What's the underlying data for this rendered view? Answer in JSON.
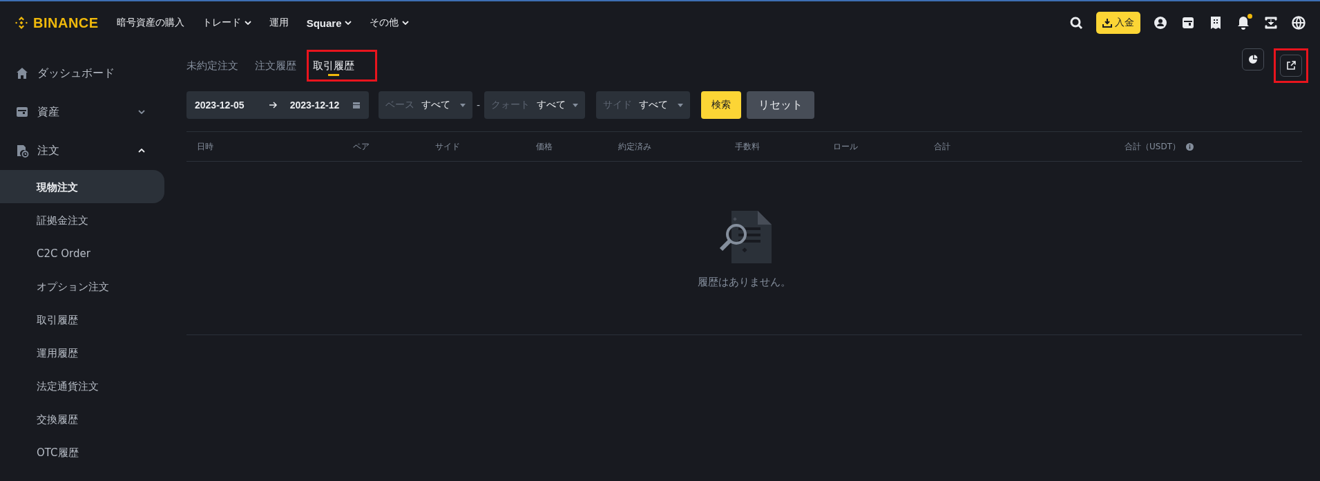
{
  "header": {
    "logo": "BINANCE",
    "nav": [
      {
        "label": "暗号資産の購入",
        "dropdown": false,
        "bold": false
      },
      {
        "label": "トレード",
        "dropdown": true,
        "bold": false
      },
      {
        "label": "運用",
        "dropdown": false,
        "bold": false
      },
      {
        "label": "Square",
        "dropdown": true,
        "bold": true
      },
      {
        "label": "その他",
        "dropdown": true,
        "bold": false
      }
    ],
    "deposit_button": "入金",
    "notification_badge": true
  },
  "sidebar": {
    "items": [
      {
        "label": "ダッシュボード",
        "kind": "link"
      },
      {
        "label": "資産",
        "kind": "group",
        "expanded": false
      },
      {
        "label": "注文",
        "kind": "group",
        "expanded": true,
        "children": [
          {
            "label": "現物注文",
            "selected": true
          },
          {
            "label": "証拠金注文",
            "selected": false
          },
          {
            "label": "C2C Order",
            "selected": false
          },
          {
            "label": "オプション注文",
            "selected": false
          },
          {
            "label": "取引履歴",
            "selected": false
          },
          {
            "label": "運用履歴",
            "selected": false
          },
          {
            "label": "法定通貨注文",
            "selected": false
          },
          {
            "label": "交換履歴",
            "selected": false
          },
          {
            "label": "OTC履歴",
            "selected": false
          }
        ]
      }
    ]
  },
  "tabs": [
    {
      "label": "未約定注文",
      "selected": false,
      "highlighted": false
    },
    {
      "label": "注文履歴",
      "selected": false,
      "highlighted": false
    },
    {
      "label": "取引履歴",
      "selected": true,
      "highlighted": true
    }
  ],
  "toolbar_buttons": [
    {
      "kind": "chart",
      "highlighted": false
    },
    {
      "kind": "export",
      "highlighted": true
    }
  ],
  "filters": {
    "date_start": "2023-12-05",
    "date_end": "2023-12-12",
    "selects": [
      {
        "label": "ベース",
        "value": "すべて"
      },
      {
        "label": "クォート",
        "value": "すべて"
      },
      {
        "label": "サイド",
        "value": "すべて"
      }
    ],
    "pair_separator": "-",
    "search_button": "検索",
    "reset_button": "リセット"
  },
  "table": {
    "columns": [
      {
        "label": "日時",
        "info": false
      },
      {
        "label": "ペア",
        "info": false
      },
      {
        "label": "サイド",
        "info": false
      },
      {
        "label": "価格",
        "info": false
      },
      {
        "label": "約定済み",
        "info": false
      },
      {
        "label": "手数料",
        "info": false
      },
      {
        "label": "ロール",
        "info": false
      },
      {
        "label": "合計",
        "info": false
      },
      {
        "label": "合計（USDT）",
        "info": true
      }
    ],
    "empty_text": "履歴はありません。"
  }
}
